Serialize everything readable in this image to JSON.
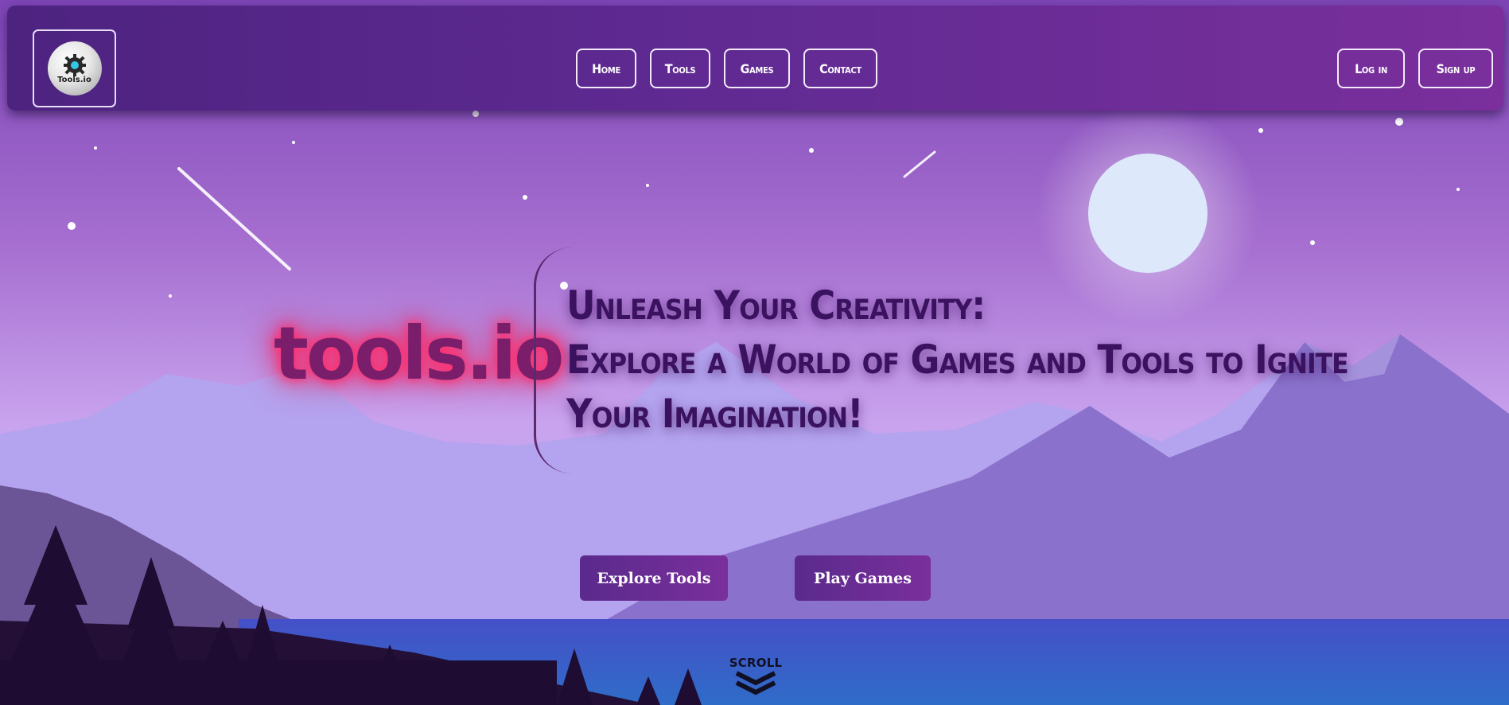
{
  "navbar": {
    "logo": {
      "text": "Tools.io",
      "icon": "gear-icon"
    },
    "links": [
      {
        "label": "Home"
      },
      {
        "label": "Tools"
      },
      {
        "label": "Games"
      },
      {
        "label": "Contact"
      }
    ],
    "auth": {
      "login_label": "Log in",
      "signup_label": "Sign up"
    }
  },
  "hero": {
    "brand": "tools.io",
    "tagline": [
      "Unleash Your Creativity:",
      "Explore a World of Games and Tools to Ignite",
      "Your Imagination!"
    ],
    "buttons": {
      "explore_label": "Explore Tools",
      "play_label": "Play Games"
    },
    "scroll_label": "SCROLL"
  },
  "colors": {
    "navbar": "#5f2a92",
    "brand_glow": "#ff2e6e",
    "tagline": "#3b1260",
    "button": "#6a2c94",
    "sky_top": "#8a4fc0",
    "lake": "#3b4ec4"
  }
}
